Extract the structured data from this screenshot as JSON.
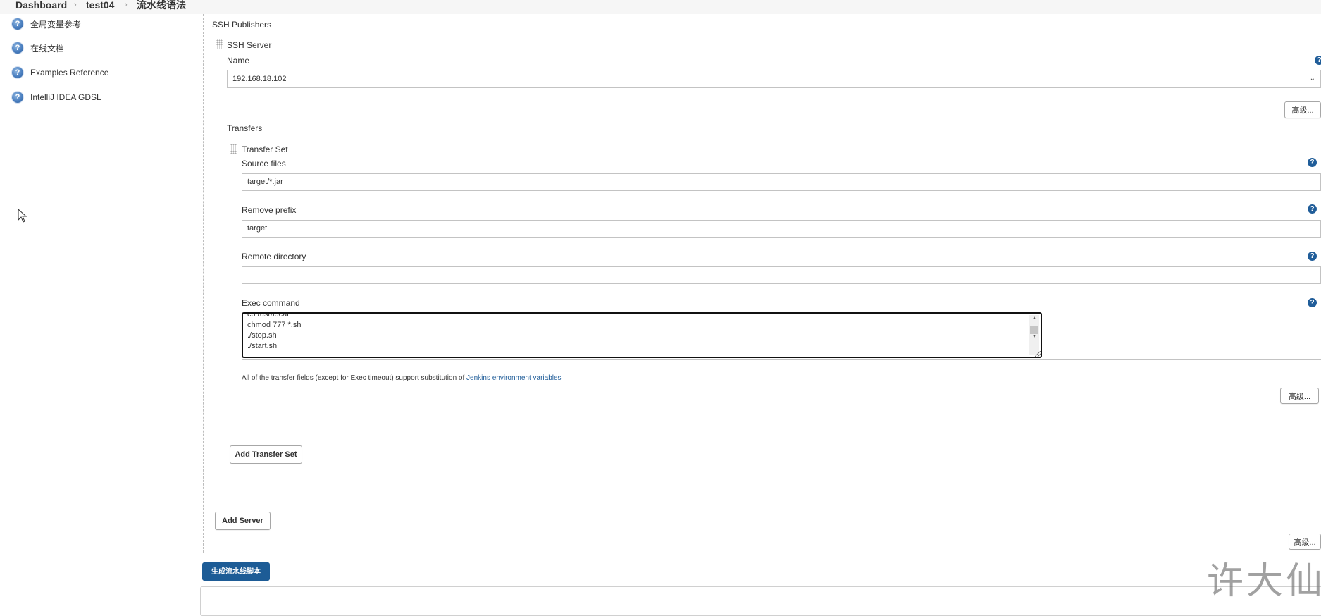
{
  "breadcrumb": {
    "items": [
      "Dashboard",
      "test04",
      "流水线语法"
    ]
  },
  "sidebar": {
    "items": [
      {
        "label": "全局变量参考",
        "icon": "help-icon"
      },
      {
        "label": "在线文档",
        "icon": "help-icon"
      },
      {
        "label": "Examples Reference",
        "icon": "help-icon"
      },
      {
        "label": "IntelliJ IDEA GDSL",
        "icon": "help-icon"
      }
    ]
  },
  "publishers": {
    "title": "SSH Publishers",
    "server_section": "SSH Server",
    "name_label": "Name",
    "name_value": "192.168.18.102",
    "advanced_label": "高级...",
    "transfers_label": "Transfers",
    "transfer_set": {
      "title": "Transfer Set",
      "source_files_label": "Source files",
      "source_files_value": "target/*.jar",
      "remove_prefix_label": "Remove prefix",
      "remove_prefix_value": "target",
      "remote_directory_label": "Remote directory",
      "remote_directory_value": "",
      "exec_command_label": "Exec command",
      "exec_command_lines": [
        "cd /usr/local",
        "chmod 777 *.sh",
        "./stop.sh",
        "./start.sh"
      ],
      "note_text": "All of the transfer fields (except for Exec timeout) support substitution of ",
      "note_link": "Jenkins environment variables",
      "advanced_label": "高级..."
    },
    "add_transfer_set_label": "Add Transfer Set",
    "add_server_label": "Add Server",
    "outer_advanced_label": "高级..."
  },
  "generate_button_label": "生成流水线脚本",
  "watermark": "许大仙",
  "colors": {
    "primary": "#1d5c96",
    "help_icon": "#205d99",
    "link": "#205d99"
  }
}
